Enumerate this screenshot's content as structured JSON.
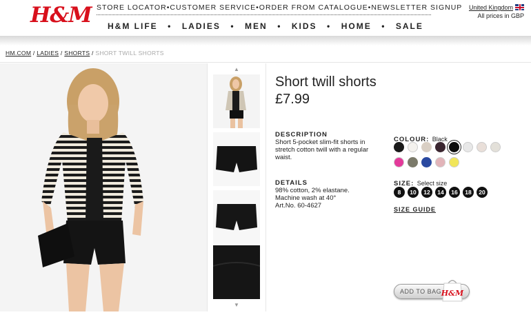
{
  "brand": {
    "logo_text": "H&M",
    "logo_color": "#d8101c"
  },
  "util_nav": [
    "STORE LOCATOR",
    "CUSTOMER SERVICE",
    "ORDER FROM CATALOGUE",
    "NEWSLETTER SIGNUP"
  ],
  "main_nav": [
    "H&M LIFE",
    "LADIES",
    "MEN",
    "KIDS",
    "HOME",
    "SALE"
  ],
  "locale": {
    "country": "United Kingdom",
    "currency_note": "All prices in GBP"
  },
  "breadcrumb": [
    "HM.COM",
    "LADIES",
    "SHORTS",
    "SHORT TWILL SHORTS"
  ],
  "product": {
    "title": "Short twill shorts",
    "price": "£7.99",
    "description_label": "DESCRIPTION",
    "description": "Short 5-pocket slim-fit shorts in stretch cotton twill with a regular waist.",
    "details_label": "DETAILS",
    "details": [
      "98% cotton, 2% elastane.",
      "Machine wash at 40°",
      "Art.No. 60-4627"
    ],
    "colour_label": "COLOUR:",
    "colour_value": "Black",
    "swatches": [
      "#1a1a1a",
      "#f4f2ee",
      "#d9cfc4",
      "#3a2630",
      "#0d0d0d",
      "#e8e8e8",
      "#e9dfd9",
      "#e3e0d9",
      "#e33a9a",
      "#7b7a6a",
      "#2a49a0",
      "#e2b4b9",
      "#f1e65a"
    ],
    "size_label": "SIZE:",
    "size_value": "Select size",
    "sizes": [
      "8",
      "10",
      "12",
      "14",
      "16",
      "18",
      "20"
    ],
    "size_guide": "SIZE GUIDE",
    "add_to_bag": "ADD TO BAG",
    "bag_logo": "H&M"
  }
}
